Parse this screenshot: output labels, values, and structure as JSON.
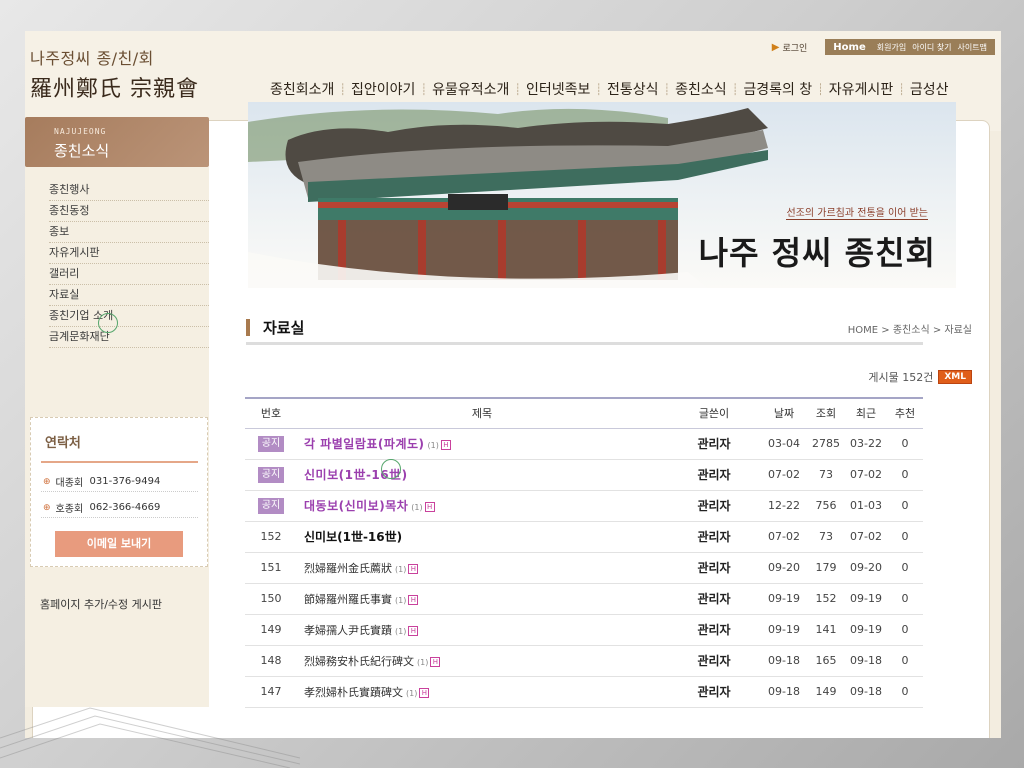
{
  "brand": {
    "ko": "나주정씨 종/친/회",
    "cn": "羅州鄭氏 宗親會"
  },
  "util": {
    "login": "로그인",
    "home": "Home",
    "join": "회원가입",
    "find_id": "아이디 찾기",
    "sitemap": "사이트맵"
  },
  "gnb": [
    "종친회소개",
    "집안이야기",
    "유물유적소개",
    "인터넷족보",
    "전통상식",
    "종친소식",
    "금경록의 창",
    "자유게시판",
    "금성산"
  ],
  "sidebar": {
    "head_en": "NAJUJEONG",
    "head_ko": "종친소식",
    "items": [
      "종친행사",
      "종친동정",
      "종보",
      "자유게시판",
      "갤러리",
      "자료실",
      "종친기업 소개",
      "금계문화재단"
    ]
  },
  "contact": {
    "heading": "연락처",
    "rows": [
      {
        "label": "대종회",
        "phone": "031-376-9494"
      },
      {
        "label": "호종회",
        "phone": "062-366-4669"
      }
    ],
    "mail_button": "이메일 보내기"
  },
  "side_link": "홈페이지 추가/수정 게시판",
  "banner": {
    "slogan": "선조의 가르침과 전통을 이어 받는",
    "name": "나주 정씨 종친회"
  },
  "page": {
    "title": "자료실",
    "breadcrumb": "HOME > 종친소식 > 자료실",
    "count_text": "게시물 152건",
    "xml_badge": "XML"
  },
  "table": {
    "headers": {
      "no": "번호",
      "title": "제목",
      "writer": "글쓴이",
      "date": "날짜",
      "views": "조회",
      "recent": "최근",
      "recommend": "추천"
    },
    "rows": [
      {
        "no": "공지",
        "title": "각 파별일람표(파계도)",
        "comments": "(1)",
        "writer": "관리자",
        "date": "03-04",
        "views": "2785",
        "recent": "03-22",
        "recommend": "0"
      },
      {
        "no": "공지",
        "title": "신미보(1世-16世)",
        "comments": "",
        "writer": "관리자",
        "date": "07-02",
        "views": "73",
        "recent": "07-02",
        "recommend": "0"
      },
      {
        "no": "공지",
        "title": "대동보(신미보)목차",
        "comments": "(1)",
        "writer": "관리자",
        "date": "12-22",
        "views": "756",
        "recent": "01-03",
        "recommend": "0"
      },
      {
        "no": "152",
        "title": "신미보(1世-16世)",
        "comments": "",
        "writer": "관리자",
        "date": "07-02",
        "views": "73",
        "recent": "07-02",
        "recommend": "0"
      },
      {
        "no": "151",
        "title": "烈婦羅州金氏薦狀",
        "comments": "(1)",
        "writer": "관리자",
        "date": "09-20",
        "views": "179",
        "recent": "09-20",
        "recommend": "0"
      },
      {
        "no": "150",
        "title": "節婦羅州羅氏事實",
        "comments": "(1)",
        "writer": "관리자",
        "date": "09-19",
        "views": "152",
        "recent": "09-19",
        "recommend": "0"
      },
      {
        "no": "149",
        "title": "孝婦孺人尹氏實蹟",
        "comments": "(1)",
        "writer": "관리자",
        "date": "09-19",
        "views": "141",
        "recent": "09-19",
        "recommend": "0"
      },
      {
        "no": "148",
        "title": "烈婦務安朴氏紀行碑文",
        "comments": "(1)",
        "writer": "관리자",
        "date": "09-18",
        "views": "165",
        "recent": "09-18",
        "recommend": "0"
      },
      {
        "no": "147",
        "title": "孝烈婦朴氏實蹟碑文",
        "comments": "(1)",
        "writer": "관리자",
        "date": "09-18",
        "views": "149",
        "recent": "09-18",
        "recommend": "0"
      }
    ]
  },
  "icons": {
    "login": "pointer-icon",
    "new_post": "h-icon",
    "bullet": "arrow-bullet-icon"
  },
  "colors": {
    "accent": "#a87a4e",
    "notice_badge": "#b28cc4",
    "notice_title": "#9b3fae",
    "xml": "#e05e1a",
    "contact_button": "#e89b7e"
  }
}
